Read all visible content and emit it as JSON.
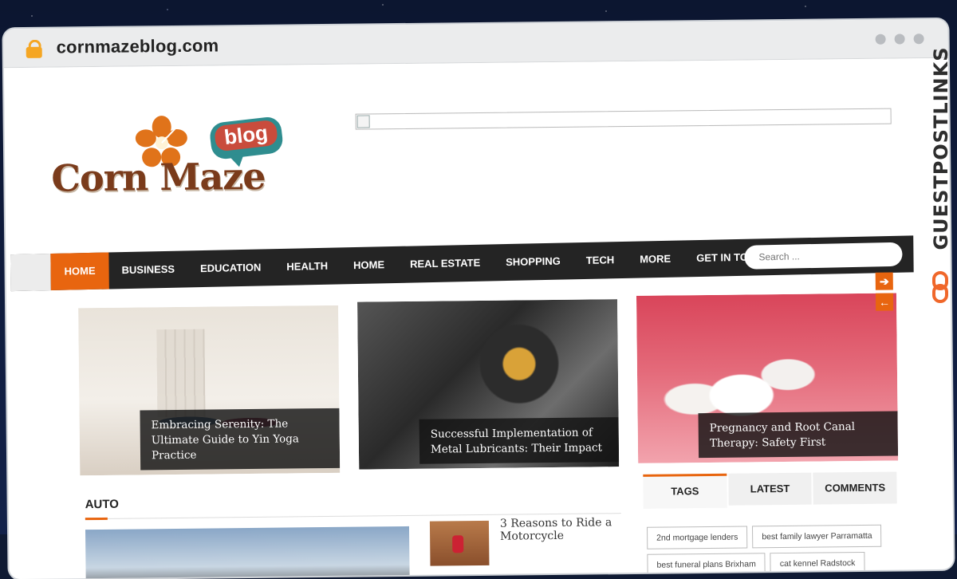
{
  "browser": {
    "url": "cornmazeblog.com"
  },
  "logo": {
    "bubble_text": "blog",
    "brand": "Corn Maze"
  },
  "nav": {
    "items": [
      {
        "label": "HOME"
      },
      {
        "label": "BUSINESS"
      },
      {
        "label": "EDUCATION"
      },
      {
        "label": "HEALTH"
      },
      {
        "label": "HOME"
      },
      {
        "label": "REAL ESTATE"
      },
      {
        "label": "SHOPPING"
      },
      {
        "label": "TECH"
      },
      {
        "label": "MORE"
      },
      {
        "label": "GET IN TOUCH"
      }
    ],
    "search_placeholder": "Search ..."
  },
  "slider": {
    "slides": [
      {
        "caption": "Embracing Serenity: The Ultimate Guide to Yin Yoga Practice"
      },
      {
        "caption": "Successful Implementation of Metal Lubricants: Their Impact"
      },
      {
        "caption": "Pregnancy and Root Canal Therapy: Safety First"
      }
    ],
    "next_arrow": "➔",
    "prev_arrow": "←"
  },
  "section": {
    "title": "AUTO"
  },
  "posts": [
    {
      "title": "3 Reasons to Ride a Motorcycle"
    }
  ],
  "sidebar": {
    "tabs": [
      {
        "label": "TAGS"
      },
      {
        "label": "LATEST"
      },
      {
        "label": "COMMENTS"
      }
    ],
    "tags": [
      "2nd mortgage lenders",
      "best family lawyer Parramatta",
      "best funeral plans Brixham",
      "cat kennel Radstock"
    ]
  },
  "watermark": {
    "text": "GUESTPOSTLINKS"
  },
  "colors": {
    "accent": "#e8650f",
    "nav_bg": "#242424"
  }
}
